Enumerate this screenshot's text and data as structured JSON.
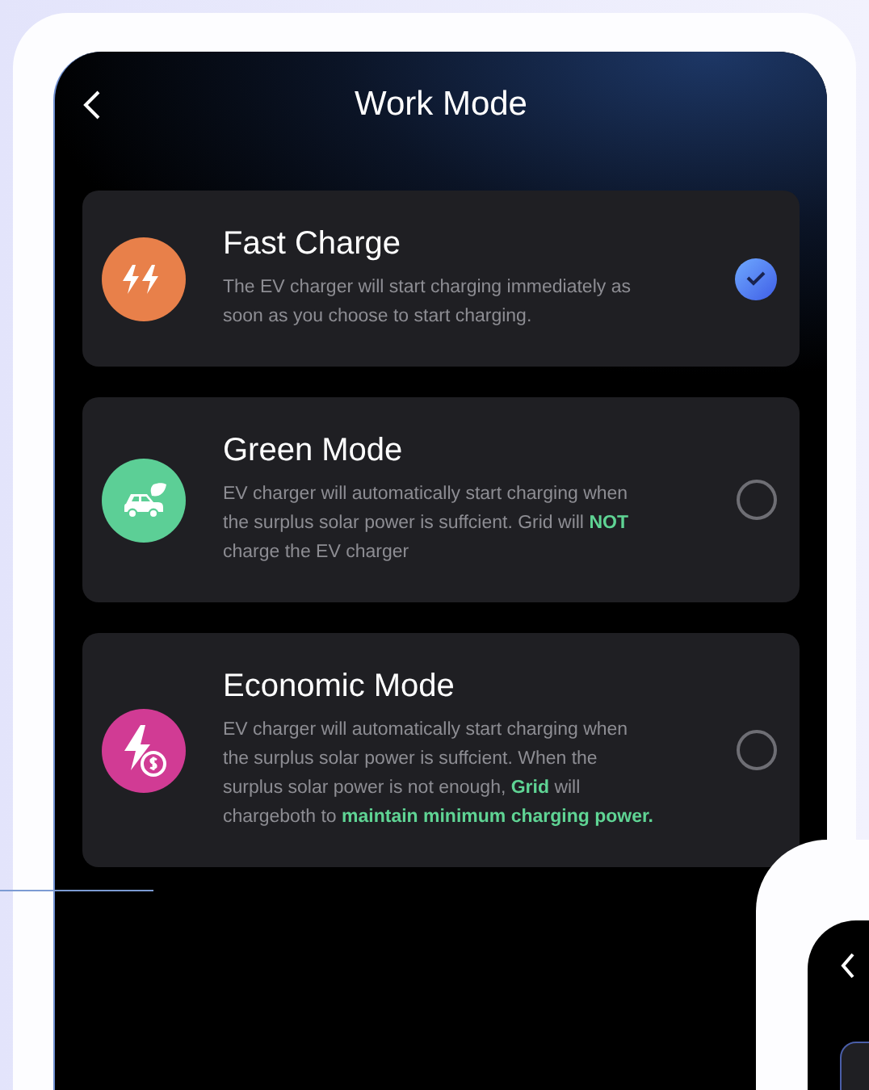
{
  "header": {
    "title": "Work Mode"
  },
  "modes": [
    {
      "kind": "fast",
      "color": "#e8804a",
      "title": "Fast Charge",
      "description": "The EV charger will start charging immediately as soon as you choose to start charging.",
      "selected": true
    },
    {
      "kind": "green",
      "color": "#5ccf96",
      "title": "Green Mode",
      "description": "EV charger will automatically start charging when the surplus solar power is suffcient. Grid will **NOT** charge the EV charger",
      "selected": false
    },
    {
      "kind": "economic",
      "color": "#d13b94",
      "title": "Economic Mode",
      "description": "EV charger will automatically start charging when the surplus solar power is suffcient. When the surplus solar power is not enough, **Grid** will chargeboth to **maintain minimum charging power.**",
      "selected": false
    }
  ]
}
